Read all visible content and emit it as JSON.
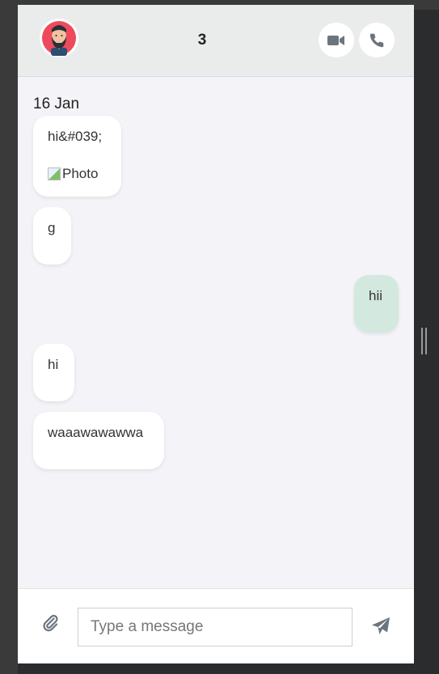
{
  "header": {
    "title": "3",
    "avatar_icon": "bearded-man-avatar",
    "video_icon": "video-camera-icon",
    "phone_icon": "phone-icon"
  },
  "conversation": {
    "date_label": "16 Jan",
    "messages": [
      {
        "direction": "incoming",
        "text": "hi&#039;",
        "image_alt": "Photo"
      },
      {
        "direction": "incoming",
        "text": "g"
      },
      {
        "direction": "outgoing",
        "text": "hii"
      },
      {
        "direction": "incoming",
        "text": "hi"
      },
      {
        "direction": "incoming",
        "text": "waaawawawwa"
      }
    ]
  },
  "composer": {
    "placeholder": "Type a message",
    "value": "",
    "attach_icon": "paperclip-icon",
    "send_icon": "send-icon"
  },
  "colors": {
    "header_bg": "#e9eceb",
    "chat_bg": "#f3f3f8",
    "incoming_bubble": "#ffffff",
    "outgoing_bubble": "#d3e8de",
    "icon_gray": "#6c757d"
  }
}
